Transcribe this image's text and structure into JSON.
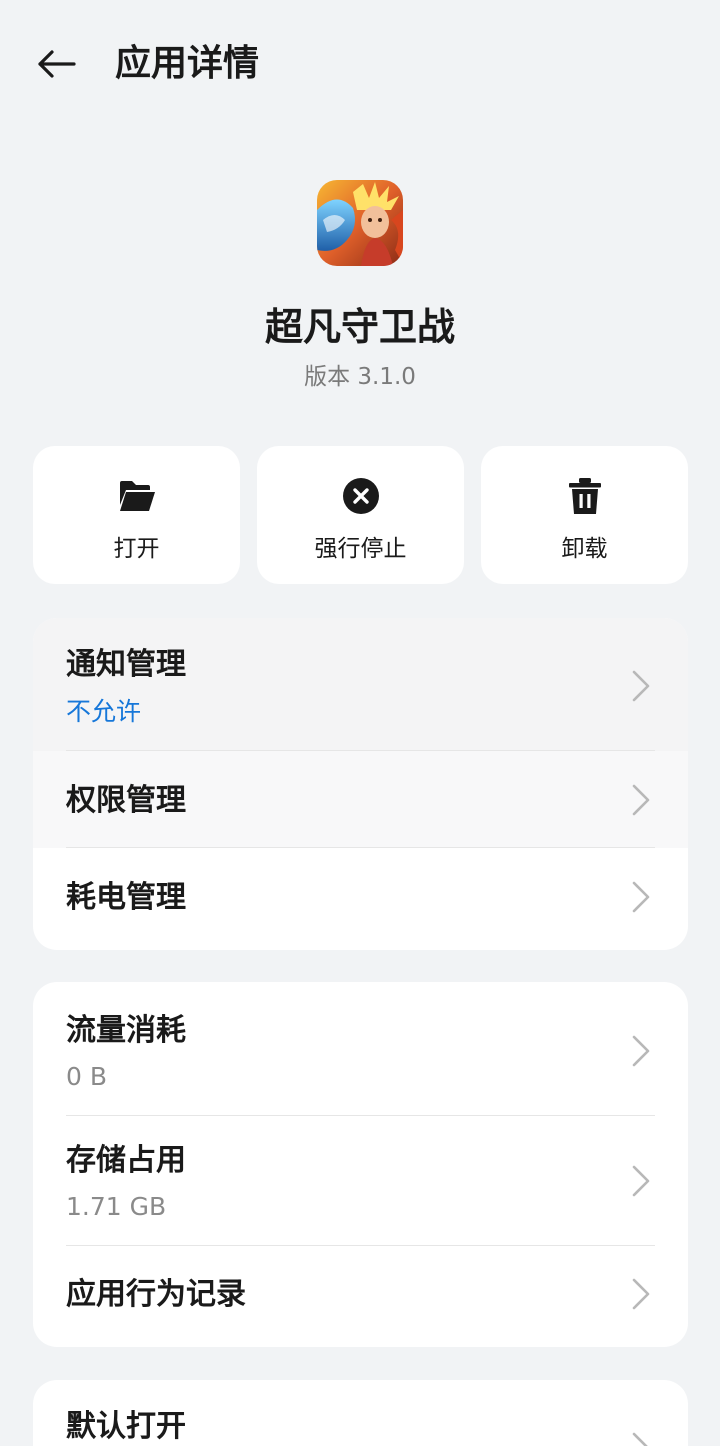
{
  "header": {
    "title": "应用详情"
  },
  "app": {
    "name": "超凡守卫战",
    "version": "版本 3.1.0"
  },
  "actions": [
    {
      "label": "打开",
      "icon": "folder-open-icon"
    },
    {
      "label": "强行停止",
      "icon": "close-circle-icon"
    },
    {
      "label": "卸载",
      "icon": "trash-icon"
    }
  ],
  "group1": {
    "notification": {
      "title": "通知管理",
      "value": "不允许"
    },
    "permission": {
      "title": "权限管理"
    },
    "battery": {
      "title": "耗电管理"
    }
  },
  "group2": {
    "data_usage": {
      "title": "流量消耗",
      "value": "0 B"
    },
    "storage": {
      "title": "存储占用",
      "value": "1.71 GB"
    },
    "behavior": {
      "title": "应用行为记录"
    }
  },
  "group3": {
    "default_open": {
      "title": "默认打开"
    }
  },
  "colors": {
    "accent": "#1677d9",
    "background": "#f1f3f5",
    "card": "#ffffff"
  }
}
